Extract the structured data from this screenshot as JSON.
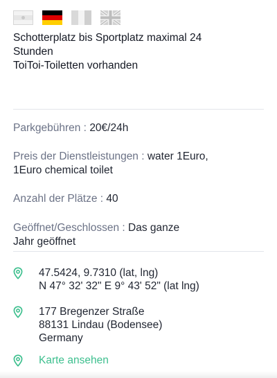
{
  "languages": [
    {
      "name": "hidden-language-1",
      "icon": "flag-icon"
    },
    {
      "name": "german",
      "icon": "flag-de-icon"
    },
    {
      "name": "hidden-language-2",
      "icon": "flag-icon"
    },
    {
      "name": "english",
      "icon": "flag-uk-icon"
    }
  ],
  "description": {
    "line1": "Schotterplatz bis Sportplatz maximal 24",
    "line2": "Stunden",
    "line3": "ToiToi-Toiletten vorhanden"
  },
  "details": {
    "parking_fee_label": "Parkgebühren :",
    "parking_fee_value": "20€/24h",
    "services_label": "Preis der Dienstleistungen :",
    "services_value_1": "water 1Euro,",
    "services_value_2": "1Euro chemical toilet",
    "spots_label": "Anzahl der Plätze :",
    "spots_value": "40",
    "opening_label": "Geöffnet/Geschlossen :",
    "opening_value_1": "Das ganze",
    "opening_value_2": "Jahr geöffnet"
  },
  "location": {
    "coords_decimal": "47.5424, 9.7310 (lat, lng)",
    "coords_dms": "N 47° 32' 32\" E 9° 43' 52\" (lat lng)",
    "address_street": "177 Bregenzer Straße",
    "address_city": "88131 Lindau (Bodensee)",
    "address_country": "Germany",
    "map_link": "Karte ansehen"
  },
  "colors": {
    "accent": "#3dbf8e",
    "label": "#6b7286",
    "divider": "#e2e4ea"
  }
}
